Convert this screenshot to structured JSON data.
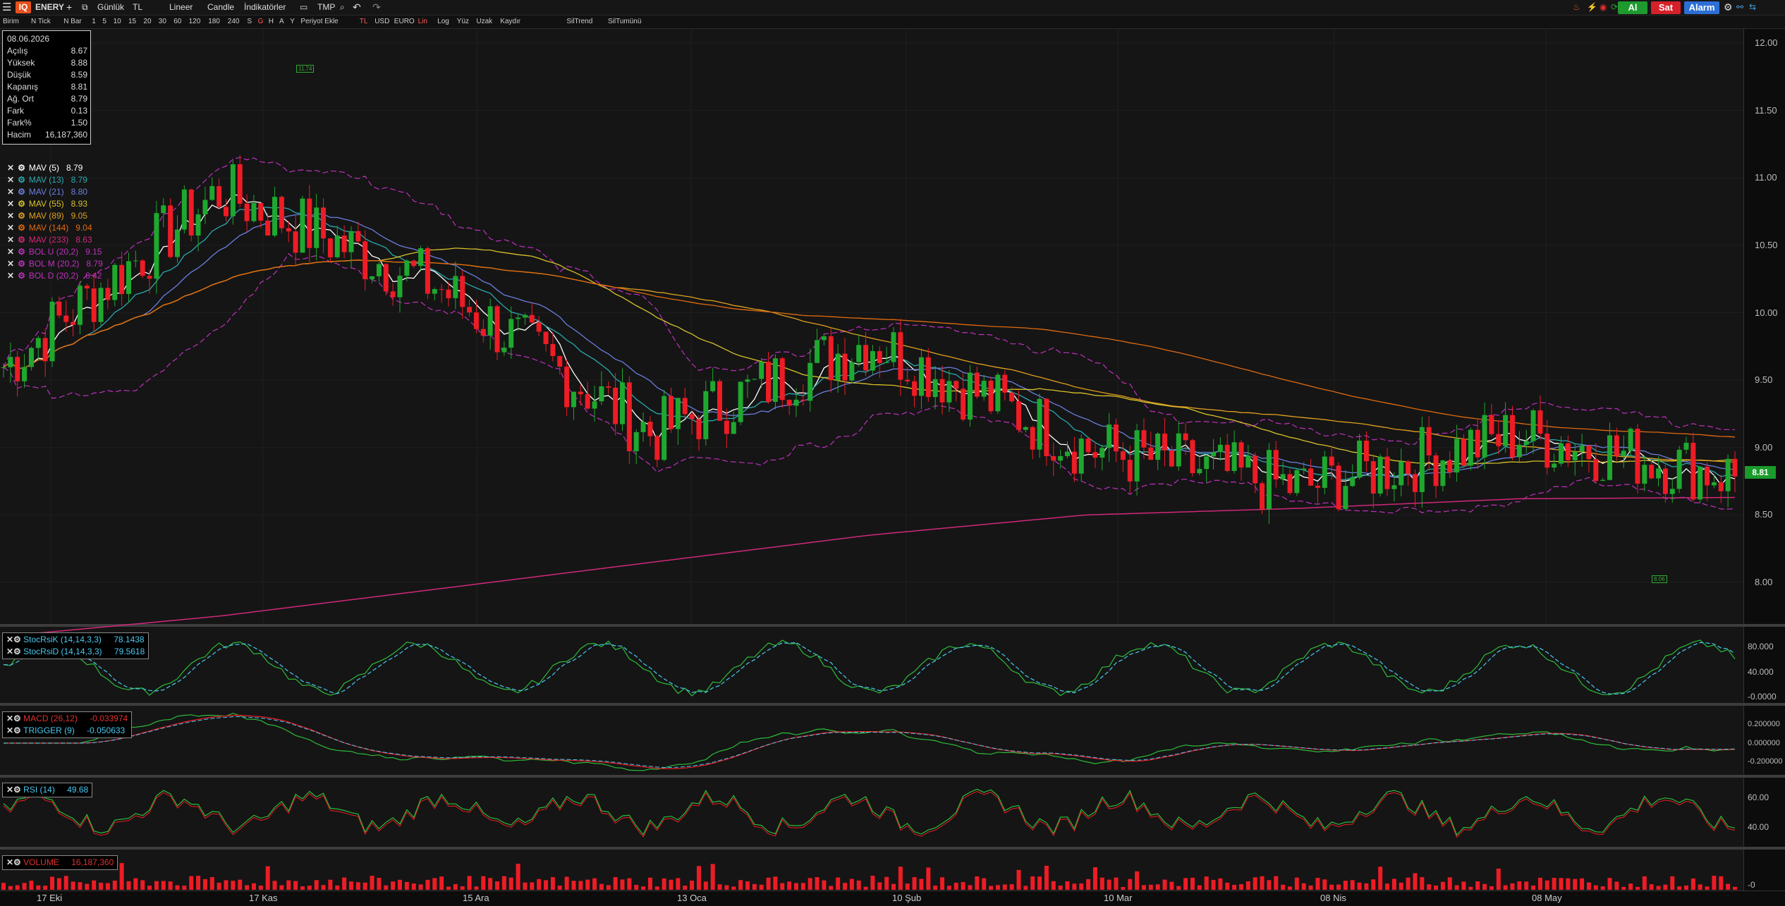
{
  "toolbar": {
    "logo": "IQ",
    "symbol": "ENERY",
    "period": "Günlük",
    "currency": "TL",
    "scale": "Lineer",
    "chart_type": "Candle",
    "indicators": "İndikatörler",
    "template": "TMP",
    "buy": "Al",
    "sell": "Sat",
    "alarm": "Alarm",
    "buy_color": "#1f9a2f",
    "sell_color": "#d6202a",
    "alarm_color": "#2c6fd6"
  },
  "toolbar2": {
    "items": [
      "Birim",
      "N Tick",
      "N Bar",
      "1",
      "5",
      "10",
      "15",
      "20",
      "30",
      "60",
      "120",
      "180",
      "240",
      "S",
      "G",
      "H",
      "A",
      "Y",
      "Periyot Ekle",
      "TL",
      "USD",
      "EURO",
      "Lin",
      "Log",
      "Yüz",
      "Uzak",
      "Kaydır",
      "SilTrend",
      "SilTumünü"
    ]
  },
  "ohlc": {
    "date": "08.06.2026",
    "rows": [
      {
        "label": "Açılış",
        "value": "8.67"
      },
      {
        "label": "Yüksek",
        "value": "8.88"
      },
      {
        "label": "Düşük",
        "value": "8.59"
      },
      {
        "label": "Kapanış",
        "value": "8.81"
      },
      {
        "label": "Ağ. Ort",
        "value": "8.79"
      },
      {
        "label": "Fark",
        "value": "0.13"
      },
      {
        "label": "Fark%",
        "value": "1.50"
      },
      {
        "label": "Hacim",
        "value": "16,187,360"
      }
    ]
  },
  "legend": [
    {
      "name": "MAV (5)",
      "value": "8.79",
      "color": "#ffffff"
    },
    {
      "name": "MAV (13)",
      "value": "8.79",
      "color": "#2aa9b0"
    },
    {
      "name": "MAV (21)",
      "value": "8.80",
      "color": "#6a7fe0"
    },
    {
      "name": "MAV (55)",
      "value": "8.93",
      "color": "#d8c22a"
    },
    {
      "name": "MAV (89)",
      "value": "9.05",
      "color": "#e0a020"
    },
    {
      "name": "MAV (144)",
      "value": "9.04",
      "color": "#e06a10"
    },
    {
      "name": "MAV (233)",
      "value": "8.63",
      "color": "#d0287a"
    },
    {
      "name": "BOL U (20,2)",
      "value": "9.15",
      "color": "#c030c0"
    },
    {
      "name": "BOL M (20,2)",
      "value": "8.79",
      "color": "#c030c0"
    },
    {
      "name": "BOL D (20,2)",
      "value": "8.42",
      "color": "#c030c0"
    }
  ],
  "price_axis": [
    "12.00",
    "11.50",
    "11.00",
    "10.50",
    "10.00",
    "9.50",
    "9.00",
    "8.50",
    "8.00"
  ],
  "last_price": "8.81",
  "high_marker": "11.74",
  "low_marker": "8.06",
  "stoch": {
    "k_name": "StocRsiK (14,14,3,3)",
    "k_value": "78.1438",
    "d_name": "StocRsiD (14,14,3,3)",
    "d_value": "79.5618",
    "axis": [
      "80.000",
      "40.000",
      "-0.0000"
    ]
  },
  "macd": {
    "macd_name": "MACD (26,12)",
    "macd_value": "-0.033974",
    "trig_name": "TRIGGER (9)",
    "trig_value": "-0.050633",
    "axis": [
      "0.200000",
      "0.000000",
      "-0.200000"
    ]
  },
  "rsi": {
    "name": "RSI (14)",
    "value": "49.68",
    "axis": [
      "60.00",
      "40.00"
    ]
  },
  "volume": {
    "name": "VOLUME",
    "value": "16,187,360",
    "axis": [
      "-0"
    ]
  },
  "dates": [
    "17 Eki",
    "17 Kas",
    "15 Ara",
    "13 Oca",
    "10 Şub",
    "10 Mar",
    "08 Nis",
    "08 May"
  ],
  "chart_data": {
    "type": "line",
    "title": "ENERY",
    "x": [
      "17 Eki",
      "17 Kas",
      "15 Ara",
      "13 Oca",
      "10 Şub",
      "10 Mar",
      "08 Nis",
      "08 May",
      "08.06.2026"
    ],
    "series": [
      {
        "name": "MAV (5)",
        "values": [
          9.6,
          10.9,
          10.2,
          9.1,
          9.8,
          9.0,
          8.7,
          9.1,
          8.79
        ]
      },
      {
        "name": "MAV (233)",
        "values": [
          7.6,
          7.75,
          7.95,
          8.15,
          8.35,
          8.5,
          8.55,
          8.62,
          8.63
        ]
      }
    ],
    "ylim": [
      7.9,
      12.1
    ]
  }
}
